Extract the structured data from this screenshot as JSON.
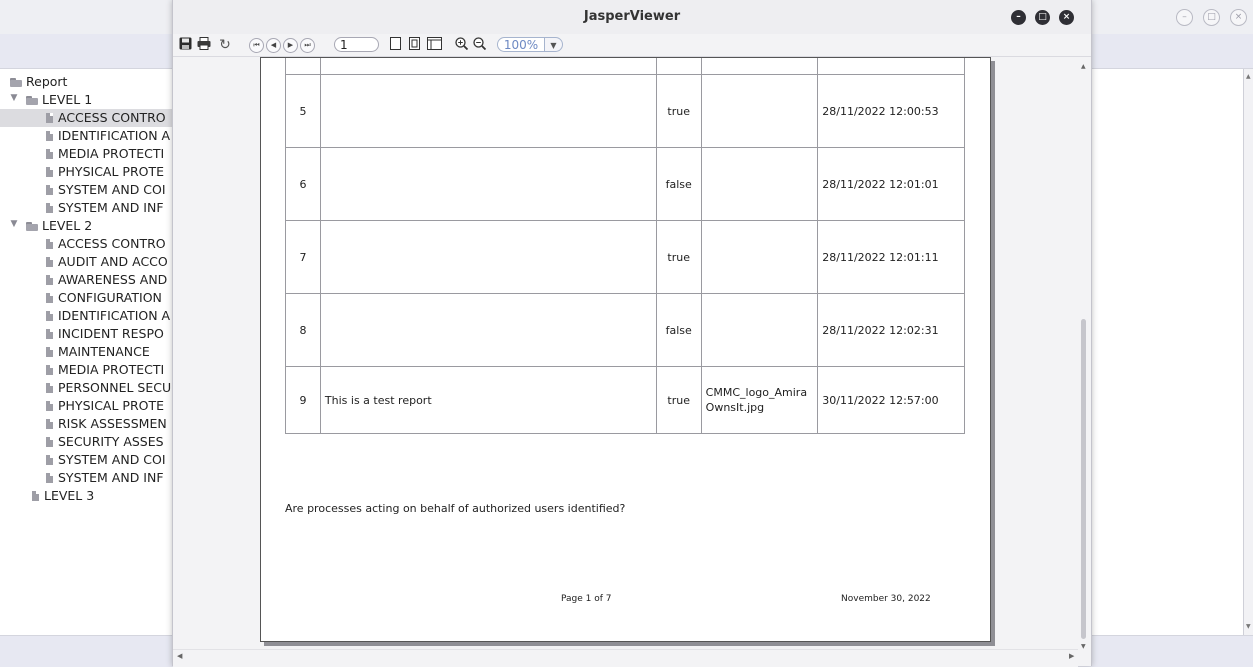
{
  "window": {
    "title": "JasperViewer"
  },
  "bg_window_controls": [
    "–",
    "□",
    "×"
  ],
  "jasper_controls": {
    "minimize": "–",
    "maximize": "□",
    "close": "×"
  },
  "toolbar": {
    "save_icon": "save-icon",
    "print_icon": "print-icon",
    "reload_icon": "reload-icon",
    "first_page": "⏮",
    "prev_page": "◀",
    "next_page": "▶",
    "last_page": "⏭",
    "page_number": "1",
    "zoom_value": "100%",
    "zoom_dropdown": "▼"
  },
  "tree": {
    "root": "Report",
    "level1": {
      "label": "LEVEL 1",
      "items": [
        "ACCESS CONTRO",
        "IDENTIFICATION A",
        "MEDIA PROTECTI",
        "PHYSICAL PROTE",
        "SYSTEM AND COI",
        "SYSTEM AND INF"
      ]
    },
    "level2": {
      "label": "LEVEL 2",
      "items": [
        "ACCESS CONTRO",
        "AUDIT AND ACCO",
        "AWARENESS AND",
        "CONFIGURATION",
        "IDENTIFICATION A",
        "INCIDENT RESPO",
        "MAINTENANCE",
        "MEDIA PROTECTI",
        "PERSONNEL SECU",
        "PHYSICAL PROTE",
        "RISK ASSESSMEN",
        "SECURITY ASSES",
        "SYSTEM AND COI",
        "SYSTEM AND INF"
      ]
    },
    "level3": {
      "label": "LEVEL 3"
    }
  },
  "report": {
    "rows": [
      {
        "no": "",
        "desc": "",
        "value": "",
        "file": "",
        "date": ""
      },
      {
        "no": "5",
        "desc": "",
        "value": "true",
        "file": "",
        "date": "28/11/2022 12:00:53"
      },
      {
        "no": "6",
        "desc": "",
        "value": "false",
        "file": "",
        "date": "28/11/2022 12:01:01"
      },
      {
        "no": "7",
        "desc": "",
        "value": "true",
        "file": "",
        "date": "28/11/2022 12:01:11"
      },
      {
        "no": "8",
        "desc": "",
        "value": "false",
        "file": "",
        "date": "28/11/2022 12:02:31"
      },
      {
        "no": "9",
        "desc": "This is a test report",
        "value": "true",
        "file": "CMMC_logo_AmiraOwnsIt.jpg",
        "date": "30/11/2022 12:57:00"
      }
    ],
    "question": "Are processes acting on behalf of authorized users identified?",
    "footer_page": "Page 1 of 7",
    "footer_date": "November 30, 2022"
  },
  "scroll_arrows": {
    "up": "▲",
    "down": "▼",
    "left": "◀",
    "right": "▶"
  }
}
